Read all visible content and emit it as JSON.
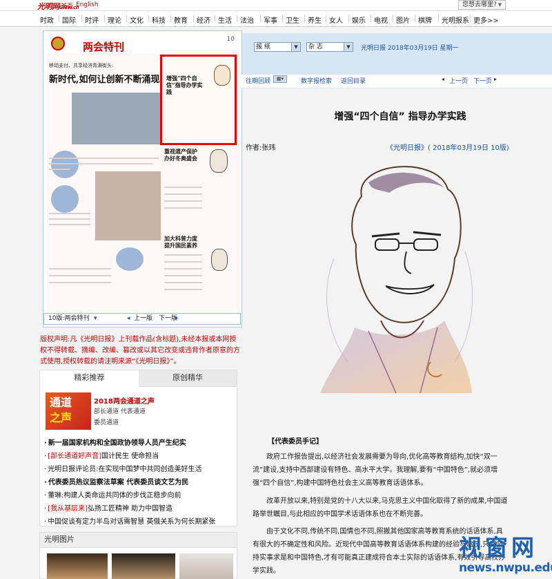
{
  "topbar": {
    "logo": "光明网",
    "logo_sub": "GMW.cn",
    "home": "首页",
    "english": "English",
    "where_btn": "您想去哪里?"
  },
  "nav": [
    "时政",
    "国际",
    "时评",
    "理论",
    "文化",
    "科技",
    "教育",
    "经济",
    "生活",
    "法治",
    "军事",
    "卫生",
    "养生",
    "女人",
    "娱乐",
    "电视",
    "图片",
    "棋牌",
    "光明报系",
    "更多>>"
  ],
  "paper_thumb": {
    "masthead": "两会特刊",
    "page_num": "10",
    "headline": "新时代,如何让创新不断涌现",
    "subhead": "移动支付、共享经济青满街头:",
    "boxed_title": "增强“四个自信”指导办学实践",
    "side_title_1": "重视遗产保护办好冬奥盛会",
    "side_title_2": "加大科普力度提升国民素养"
  },
  "page_nav": {
    "page_label": "10版:两会特刊",
    "prev": "上一版",
    "next": "下一版"
  },
  "copyright": "版权声明:凡《光明日报》上刊载作品(含标题),未经本报或本网授权不得转载、摘编、改编、篡改或以其它改变或违背作者原意的方式使用,授权转载的请注明来源“《光明日报》”。",
  "tabs": {
    "tab1": "精彩推荐",
    "tab2": "原创精华"
  },
  "promo": {
    "img_line1": "通道",
    "img_line2": "之声",
    "title": "2018两会通道之声",
    "line2": "部长通道  代表通道",
    "line3": "委员通道"
  },
  "news": [
    {
      "tag": "",
      "text": "新一届国家机构和全国政协领导人员产生纪实",
      "bold": true
    },
    {
      "tag": "[部长通道好声音]",
      "text": "国计民生  使命担当",
      "bold": false
    },
    {
      "tag": "",
      "text": "光明日报评论员:在实现中国梦中共同创造美好生活",
      "bold": false
    },
    {
      "tag": "",
      "text": "代表委员热议监察法草案  代表委员谈文艺为民",
      "bold": true
    },
    {
      "tag": "",
      "text": "董琳:构建人类命运共同体的步伐正稳步向前",
      "bold": false
    },
    {
      "tag": "[我从基层来]",
      "text": "弘扬工匠精神  助力中国智造",
      "bold": false
    },
    {
      "tag": "",
      "text": "中国促谈有定力半岛对话需智慧  英俄关系为何长期紧张",
      "bold": false
    }
  ],
  "photos_title": "光明图片",
  "right": {
    "select1": "报 纸",
    "select2": "杂 志",
    "date": "光明日报  2018年03月19日  星期一",
    "past": "往期回顾",
    "search": "数字报检索",
    "index": "返回目录",
    "prev_page": "上一页",
    "next_page": "下一页"
  },
  "article": {
    "title": "增强“四个自信”  指导办学实践",
    "author": "作者:张玮",
    "source": "《光明日报》( 2018年03月19日  10版)",
    "section": "【代表委员手记】",
    "paras": [
      "政府工作报告提出,以经济社会发展需要为导向,优化高等教育结构,加快“双一流”建设,支持中西部建设有特色、高水平大学。我理解,要有“中国特色”,就必须增强“四个自信”,构建中国特色社会主义高等教育话语体系。",
      "改革开放以来,特别是党的十八大以来,马克思主义中国化取得了新的成果,中国道路举世瞩目,与此相应的中国学术话语体系也在不断完善。",
      "由于文化不同,传统不同,国情也不同,照搬其他国家高等教育系统的话语体系,具有很大的不确定性和风险。近现代中国高等教育话语体系构建的经验与启示,只有坚持实事求是和中国特色,才有可能真正建成符合本土实际的话语体系,有效引导高校办学实践。"
    ]
  },
  "watermark": {
    "big": "视窗网",
    "url": "news.nwpu.edu.cn"
  }
}
